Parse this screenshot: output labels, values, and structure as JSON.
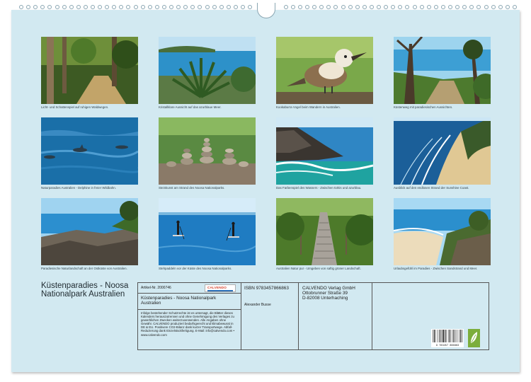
{
  "calendar": {
    "title": "Küstenparadies - Noosa Nationalpark Australien",
    "photos": [
      {
        "caption": "Licht- und Schattenspiel auf ruhigen Waldwegen.",
        "scene": "forest-path"
      },
      {
        "caption": "Kristallklare Aussicht auf das azurblaue Meer.",
        "scene": "palm-sea"
      },
      {
        "caption": "Kookaburra Vogel beim Wandern in Australien.",
        "scene": "kookaburra"
      },
      {
        "caption": "Küstenweg mit paradiesischen Aussichten.",
        "scene": "coast-trail"
      },
      {
        "caption": "Naturparadies Australien - Delphine in freier Wildbahn.",
        "scene": "dolphins"
      },
      {
        "caption": "Steinkunst am Strand des Noosa Nationalparks.",
        "scene": "stone-stacks"
      },
      {
        "caption": "Das Farbenspiel des Wassers - Zwischen türkis und azurblau.",
        "scene": "rocky-coast"
      },
      {
        "caption": "Ausblick auf den endlosen Strand der Sunshine Coast.",
        "scene": "aerial-beach"
      },
      {
        "caption": "Paradiesische Naturlandschaft an der Ostküste von Australien.",
        "scene": "rocky-shore"
      },
      {
        "caption": "Stehpaddeln vor der Küste des Noosa Nationalparks.",
        "scene": "paddle"
      },
      {
        "caption": "Australien Natur pur - Umgeben von saftig grüner Landschaft.",
        "scene": "boardwalk"
      },
      {
        "caption": "Urlaubsgefühl im Paradies - Zwischen Sandstrand und Meer.",
        "scene": "beach-bay"
      }
    ]
  },
  "info": {
    "article_no": "Artikel-Nr. 2000746",
    "logo_text": "CALVENDO",
    "product_title": "Küstenparadies - Noosa Nationalpark Australien",
    "notice": "Infolge bestehender Schutzrechte ist es untersagt, die Blätter dieses Kalenders herauszutrennen und ohne Genehmigung des Verlages zu gewerblichen Zwecken weiterzuverwenden. Alle Angaben ohne Gewähr. CALVENDO produziert bedarfsgerecht und klimabewusst in DE & EU. Positivere CO2-Bilanz dank kurzer Transportwege. Abfall-Reduzierung dank Einzelstückfertigung. E-Mail: info@calvendo.com • www.calvendo.com",
    "isbn": "ISBN 9783457866863",
    "author": "Alexander Busse",
    "publisher": "CALVENDO Verlag GmbH",
    "street": "Ottobrunner Straße 39",
    "city": "D-82008 Unterhaching",
    "barcode_number": "9 783457 866863"
  }
}
